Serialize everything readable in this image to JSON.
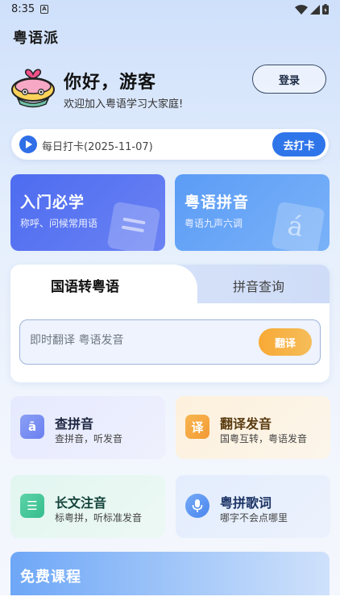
{
  "status_bar": {
    "time": "8:35",
    "notification_letter": "A"
  },
  "app": {
    "title": "粤语派"
  },
  "user": {
    "greeting": "你好，游客",
    "welcome": "欢迎加入粤语学习大家庭!",
    "login_label": "登录"
  },
  "checkin": {
    "text": "每日打卡(2025-11-07)",
    "button_label": "去打卡"
  },
  "feature_cards": [
    {
      "title": "入门必学",
      "subtitle": "称呼、问候常用语",
      "deco_icon": "document-icon"
    },
    {
      "title": "粤语拼音",
      "subtitle": "粤语九声六调",
      "deco_letter": "á"
    }
  ],
  "translate": {
    "tabs": [
      {
        "label": "国语转粤语",
        "active": true
      },
      {
        "label": "拼音查询",
        "active": false
      }
    ],
    "placeholder": "即时翻译 粤语发音",
    "button_label": "翻译"
  },
  "tools": [
    {
      "title": "查拼音",
      "subtitle": "查拼音，听发音",
      "icon": "pinyin-icon",
      "icon_glyph": "ā"
    },
    {
      "title": "翻译发音",
      "subtitle": "国粤互转，粤语发音",
      "icon": "translate-icon",
      "icon_glyph": "译"
    },
    {
      "title": "长文注音",
      "subtitle": "标粤拼，听标准发音",
      "icon": "document-icon",
      "icon_glyph": "☰"
    },
    {
      "title": "粤拼歌词",
      "subtitle": "哪字不会点哪里",
      "icon": "microphone-icon",
      "icon_glyph": "🎤"
    }
  ],
  "courses": {
    "title": "免费课程"
  },
  "colors": {
    "primary": "#2f75ea",
    "accent_orange": "#f8a935",
    "card_blue_dark": "#4d6cf0",
    "card_blue_light": "#5b9cf6"
  }
}
